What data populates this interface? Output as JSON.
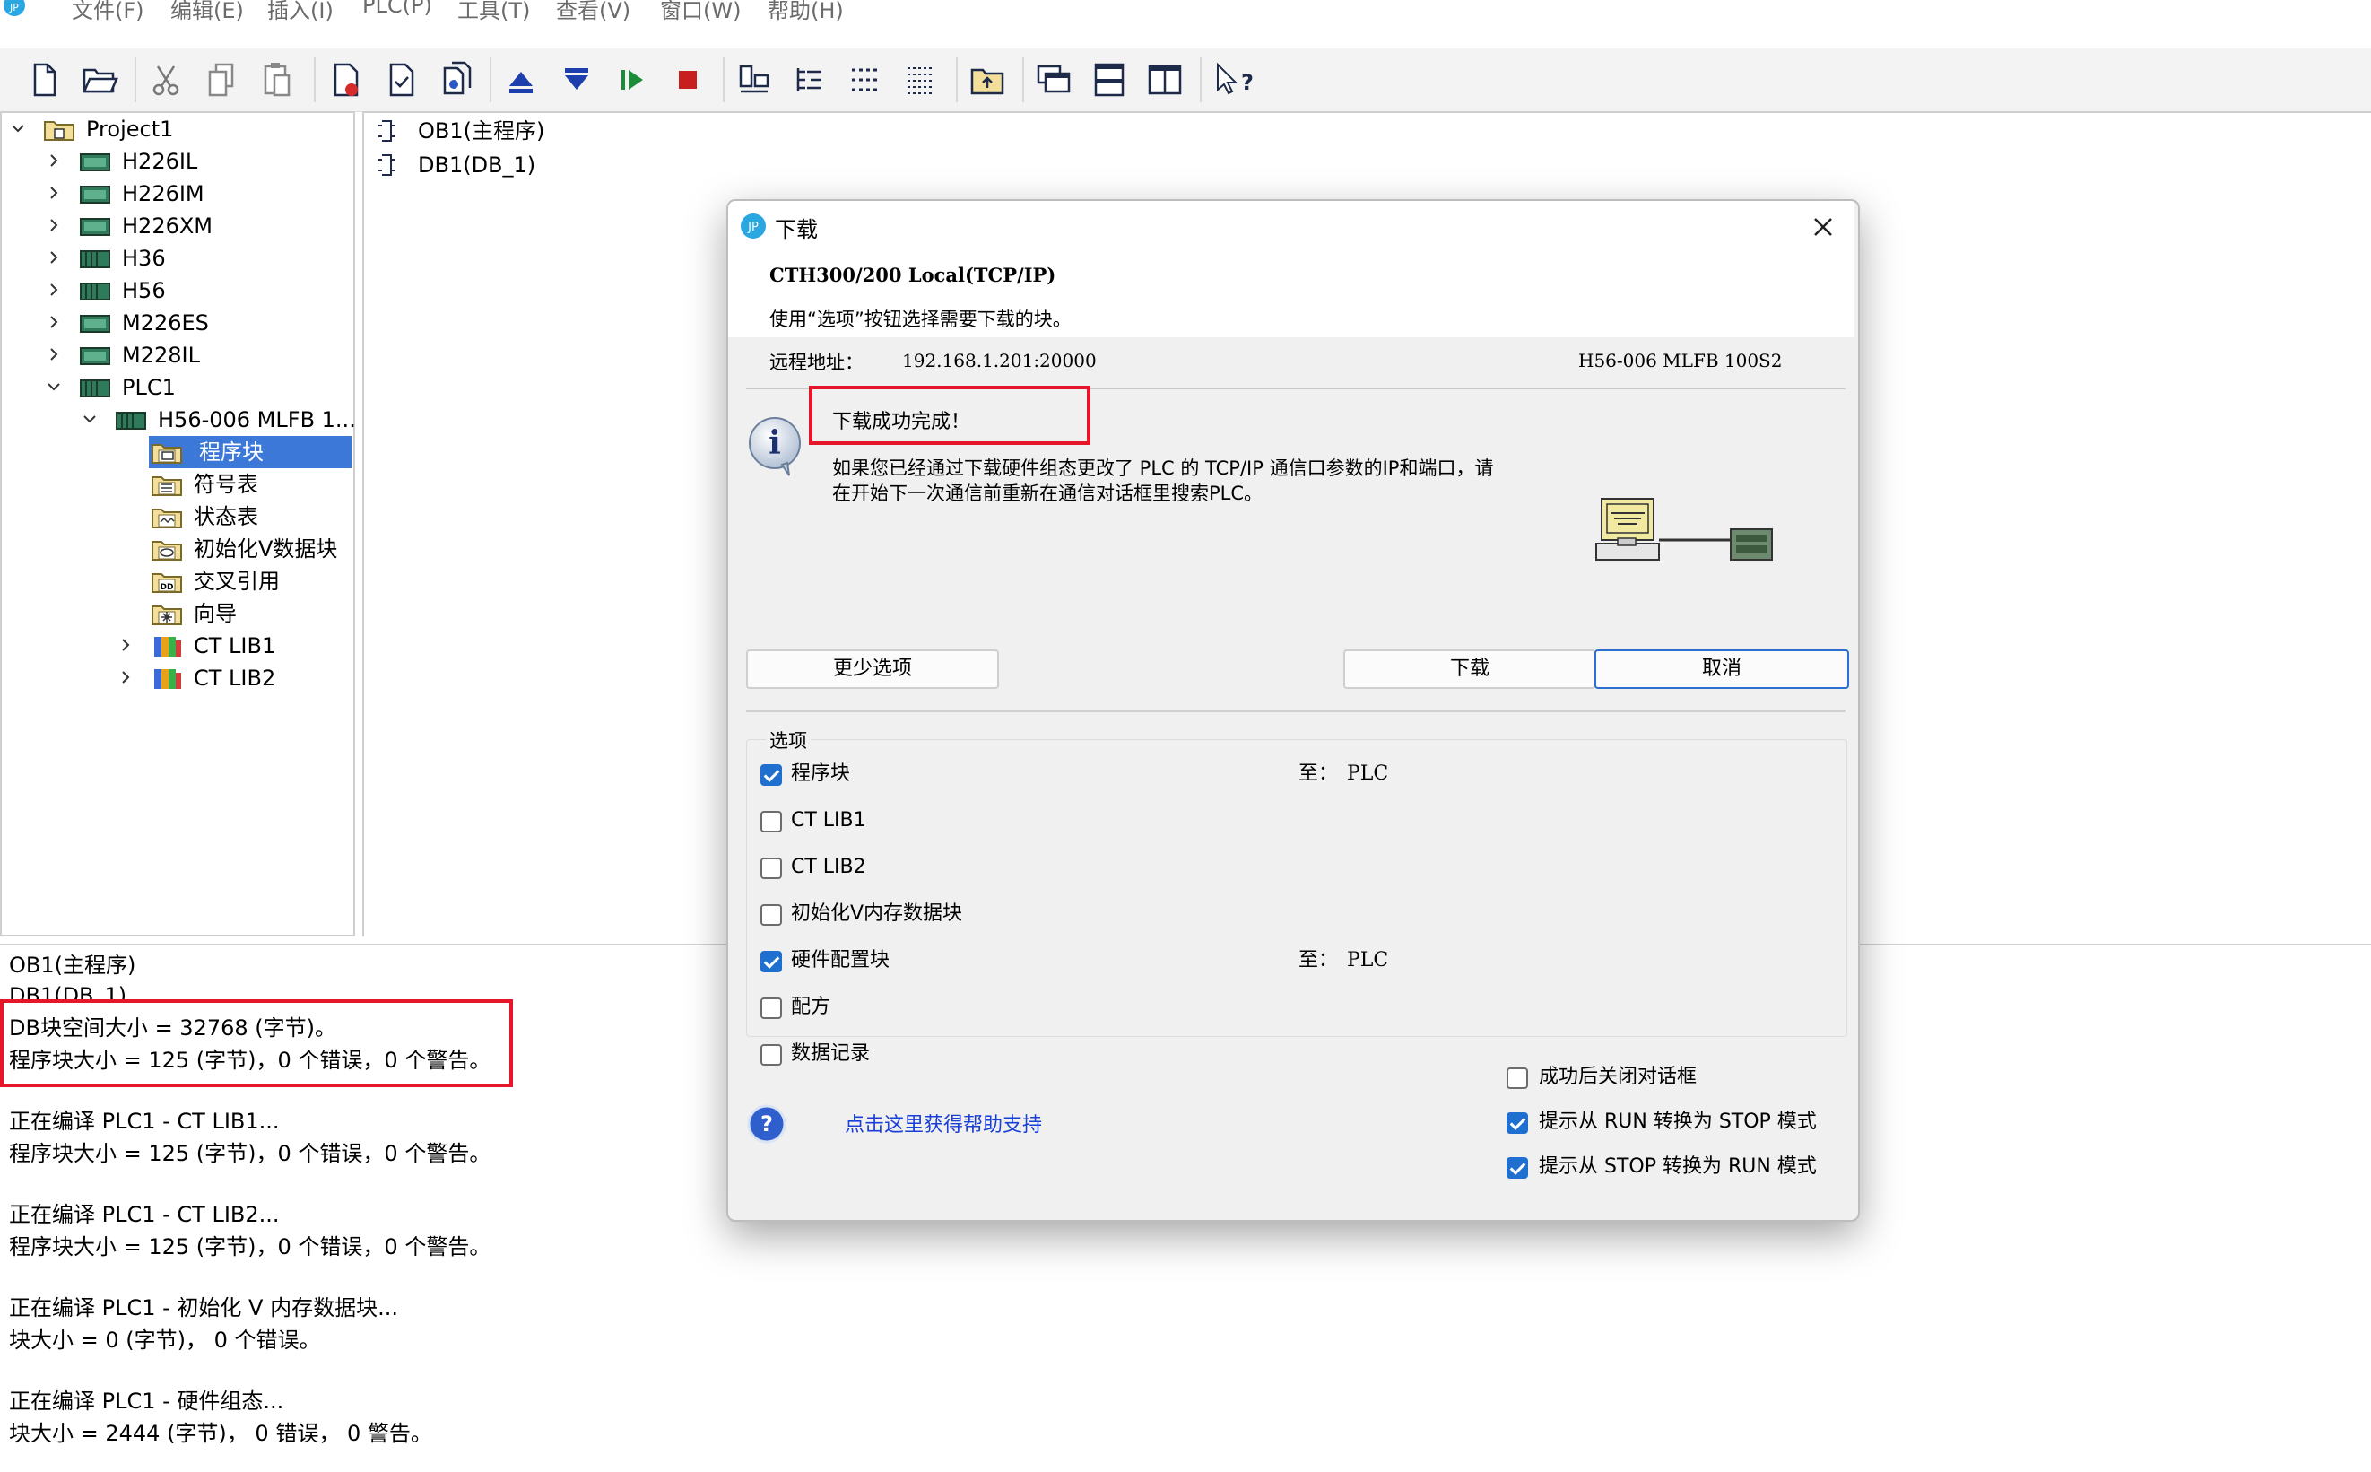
{
  "menubar": {
    "items": [
      "文件(F)",
      "编辑(E)",
      "插入(I)",
      "PLC(P)",
      "工具(T)",
      "查看(V)",
      "窗口(W)",
      "帮助(H)"
    ]
  },
  "toolbar": {
    "buttons": [
      "new-file-icon",
      "open-folder-icon",
      "cut-icon",
      "copy-icon",
      "paste-icon",
      "compile-icon",
      "check-icon",
      "compile-all-icon",
      "upload-icon",
      "download-icon",
      "run-icon",
      "stop-icon",
      "hardware-icon",
      "ladder-icon",
      "function-block-icon",
      "statement-list-icon",
      "folder-up-icon",
      "window-cascade-icon",
      "window-horizontal-icon",
      "window-vertical-icon",
      "context-help-icon"
    ]
  },
  "tree": {
    "items": [
      {
        "label": "Project1"
      },
      {
        "label": "H226IL"
      },
      {
        "label": "H226IM"
      },
      {
        "label": "H226XM"
      },
      {
        "label": "H36"
      },
      {
        "label": "H56"
      },
      {
        "label": "M226ES"
      },
      {
        "label": "M228IL"
      },
      {
        "label": "PLC1"
      },
      {
        "label": "H56-006 MLFB 1..."
      },
      {
        "label": "程序块"
      },
      {
        "label": "符号表"
      },
      {
        "label": "状态表"
      },
      {
        "label": "初始化V数据块"
      },
      {
        "label": "交叉引用"
      },
      {
        "label": "向导"
      },
      {
        "label": "CT LIB1"
      },
      {
        "label": "CT LIB2"
      }
    ]
  },
  "blocks": {
    "items": [
      "OB1(主程序)",
      "DB1(DB_1)"
    ]
  },
  "output": {
    "lines": [
      "OB1(主程序)",
      "DB1(DB_1)",
      "DB块空间大小 = 32768 (字节)。",
      "程序块大小 = 125 (字节)，0 个错误，0 个警告。",
      "正在编译 PLC1 - CT LIB1...",
      "程序块大小 = 125 (字节)，0 个错误，0 个警告。",
      "正在编译 PLC1 - CT LIB2...",
      "程序块大小 = 125 (字节)，0 个错误，0 个警告。",
      "正在编译 PLC1 - 初始化 V 内存数据块...",
      "块大小 = 0 (字节)， 0 个错误。",
      "正在编译 PLC1 - 硬件组态...",
      "块大小 = 2444 (字节)， 0 错误， 0 警告。"
    ]
  },
  "dialog": {
    "title": "下载",
    "connection": "CTH300/200 Local(TCP/IP)",
    "instruction": "使用“选项”按钮选择需要下载的块。",
    "remote_label": "远程地址：",
    "remote_address": "192.168.1.201:20000",
    "device_name": "H56-006 MLFB 100S2",
    "success_message": "下载成功完成！",
    "info_line1": "如果您已经通过下载硬件组态更改了 PLC 的 TCP/IP 通信口参数的IP和端口，请",
    "info_line2": "在开始下一次通信前重新在通信对话框里搜索PLC。",
    "buttons": {
      "fewer_options": "更少选项",
      "download": "下载",
      "cancel": "取消"
    },
    "options_group": "选项",
    "options": [
      {
        "label": "程序块",
        "checked": true,
        "target_label": "至：",
        "target": "PLC"
      },
      {
        "label": "CT LIB1",
        "checked": false,
        "target_label": "",
        "target": ""
      },
      {
        "label": "CT LIB2",
        "checked": false,
        "target_label": "",
        "target": ""
      },
      {
        "label": "初始化V内存数据块",
        "checked": false,
        "target_label": "",
        "target": ""
      },
      {
        "label": "硬件配置块",
        "checked": true,
        "target_label": "至：",
        "target": "PLC"
      },
      {
        "label": "配方",
        "checked": false,
        "target_label": "",
        "target": ""
      },
      {
        "label": "数据记录",
        "checked": false,
        "target_label": "",
        "target": ""
      }
    ],
    "help_link": "点击这里获得帮助支持",
    "bottom_checks": [
      {
        "label": "成功后关闭对话框",
        "checked": false
      },
      {
        "label": "提示从 RUN 转换为 STOP 模式",
        "checked": true
      },
      {
        "label": "提示从 STOP 转换为 RUN 模式",
        "checked": true
      }
    ]
  },
  "colors": {
    "accent": "#1f6fd1",
    "selection": "#3c78d8",
    "highlight": "#e5152a",
    "link": "#1a3fd6"
  }
}
